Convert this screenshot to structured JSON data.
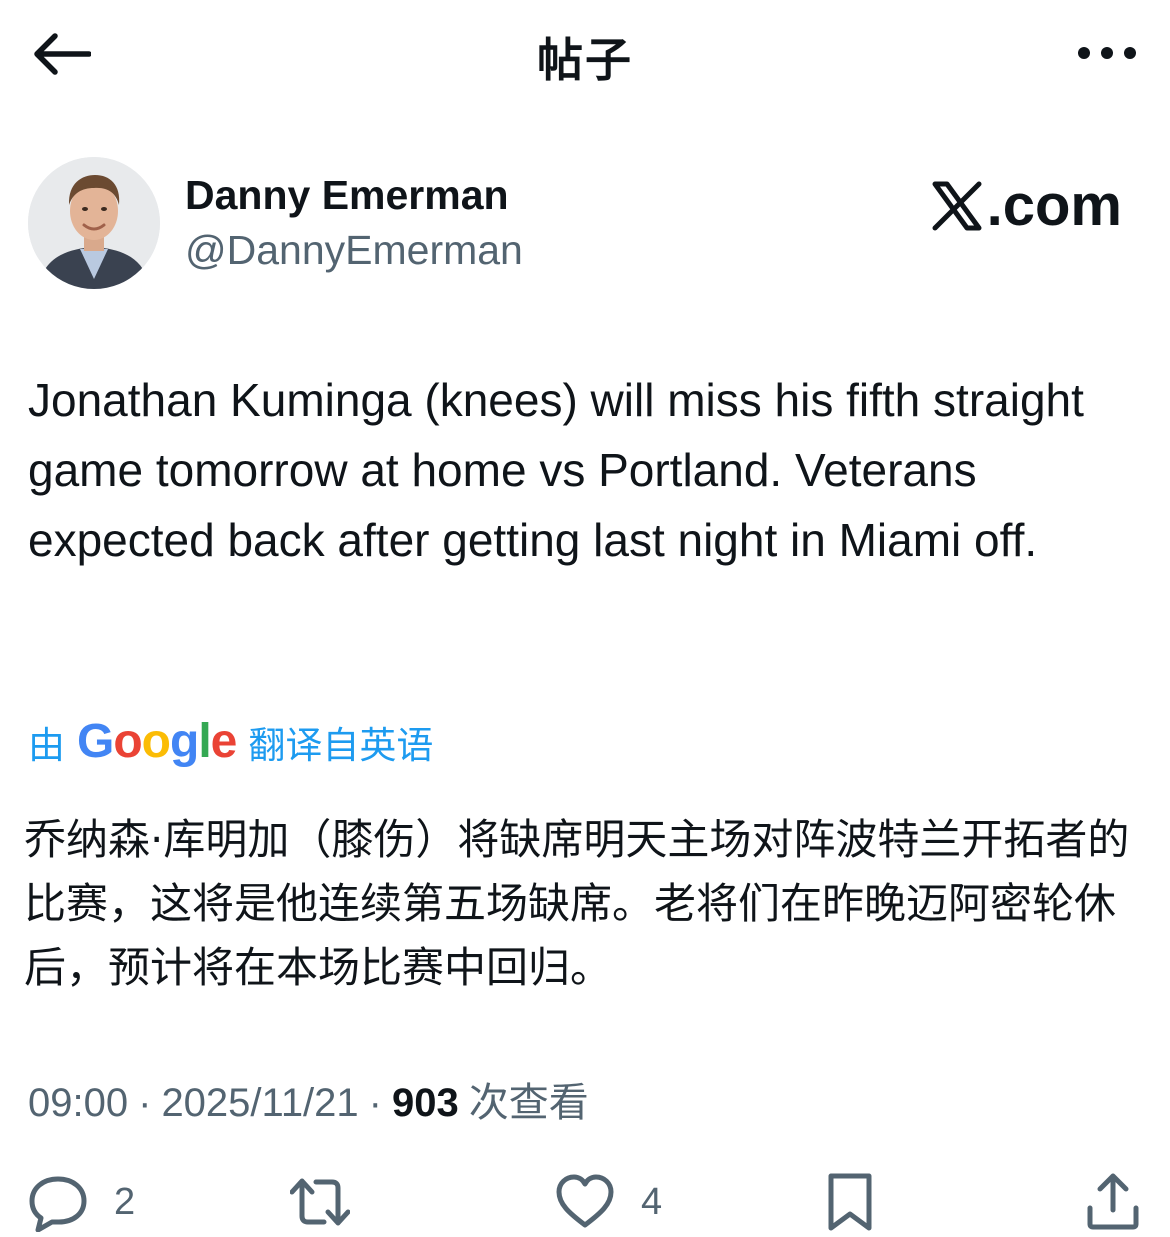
{
  "header": {
    "title": "帖子",
    "back_icon": "arrow-left-icon",
    "more_icon": "more-horizontal-icon"
  },
  "author": {
    "name": "Danny Emerman",
    "handle": "@DannyEmerman"
  },
  "watermark": {
    "x_symbol": "𝕏",
    "text": ".com"
  },
  "tweet": {
    "text": "Jonathan Kuminga (knees) will miss his fifth straight game tomorrow at home vs Portland. Veterans expected back after getting last night in Miami off."
  },
  "translation": {
    "prefix": "由",
    "provider": "Google",
    "suffix": "翻译自英语",
    "text": "乔纳森·库明加（膝伤）将缺席明天主场对阵波特兰开拓者的比赛，这将是他连续第五场缺席。老将们在昨晚迈阿密轮休后，预计将在本场比赛中回归。"
  },
  "meta": {
    "time": "09:00",
    "date": "2025/11/21",
    "separator": "·",
    "views_count": "903",
    "views_label": "次查看"
  },
  "actions": {
    "reply_count": "2",
    "like_count": "4"
  },
  "colors": {
    "text": "#0f1419",
    "secondary": "#536471",
    "link": "#1d9bf0"
  }
}
